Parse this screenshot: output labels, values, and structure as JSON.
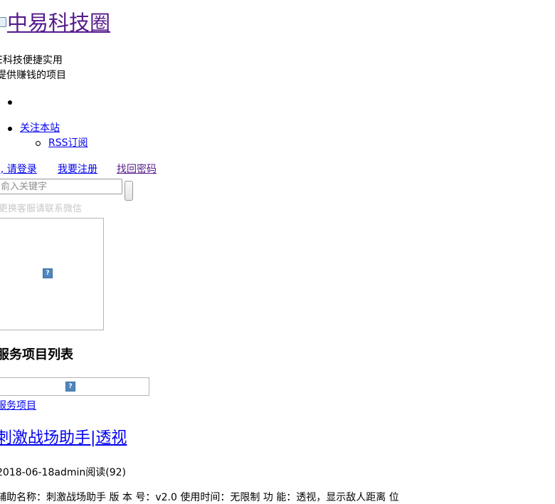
{
  "site": {
    "title": "中易科技圈",
    "tagline_line1": "E科技便捷实用",
    "tagline_line2": "提供赚钱的项目"
  },
  "nav": {
    "follow_label": "关注本站",
    "rss_label": " RSS订阅"
  },
  "auth": {
    "login_label": "i, 请登录",
    "register_label": "我要注册",
    "recover_label": "找回密码"
  },
  "search": {
    "placeholder": "俞入关键字"
  },
  "notice": {
    "text": "更换客服请联系微信"
  },
  "section": {
    "heading": "服务项目列表",
    "service_link": "服务项目"
  },
  "post": {
    "title": "刺激战场助手|透视",
    "meta": "2018-06-18admin阅读(92)",
    "excerpt": "辅助名称：刺激战场助手 版 本 号：v2.0 使用时间：无限制 功    能：透视，显示敌人距离 位"
  },
  "icons": {
    "logo": "broken-image-icon",
    "frame": "broken-image-icon",
    "banner": "broken-image-icon"
  }
}
